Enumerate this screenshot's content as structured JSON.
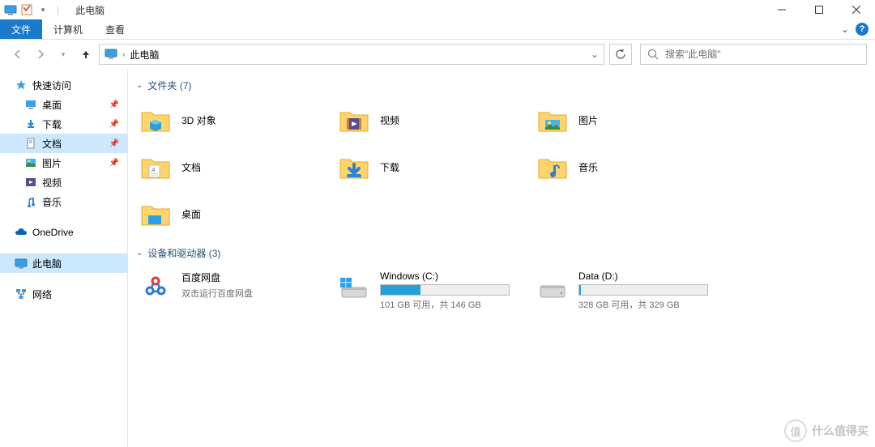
{
  "window": {
    "title": "此电脑",
    "divider": "|"
  },
  "ribbon": {
    "file": "文件",
    "computer": "计算机",
    "view": "查看"
  },
  "address": {
    "location": "此电脑",
    "chevron": "›"
  },
  "search": {
    "placeholder": "搜索\"此电脑\""
  },
  "sidebar": {
    "quickaccess": "快速访问",
    "desktop": "桌面",
    "downloads": "下载",
    "documents": "文档",
    "pictures": "图片",
    "videos": "视频",
    "music": "音乐",
    "onedrive": "OneDrive",
    "thispc": "此电脑",
    "network": "网络"
  },
  "sections": {
    "folders": "文件夹 (7)",
    "drives": "设备和驱动器 (3)"
  },
  "folders": {
    "objects3d": "3D 对象",
    "videos": "视频",
    "pictures": "图片",
    "documents": "文档",
    "downloads": "下载",
    "music": "音乐",
    "desktop": "桌面"
  },
  "drives": {
    "baidu": {
      "name": "百度网盘",
      "sub": "双击运行百度网盘"
    },
    "c": {
      "name": "Windows (C:)",
      "free": "101 GB 可用，共 146 GB",
      "fill_pct": 31
    },
    "d": {
      "name": "Data (D:)",
      "free": "328 GB 可用，共 329 GB",
      "fill_pct": 1
    }
  },
  "watermark": {
    "badge": "值",
    "text": "什么值得买"
  }
}
